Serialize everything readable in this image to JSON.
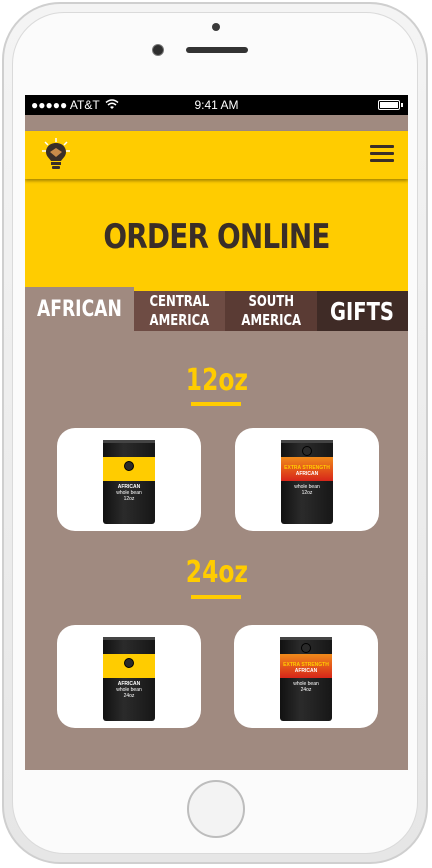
{
  "status": {
    "carrier": "●●●●● AT&T",
    "time": "9:41 AM"
  },
  "nav": {
    "logo_icon": "lightbulb-logo",
    "menu_icon": "hamburger-icon"
  },
  "hero": {
    "title": "ORDER ONLINE"
  },
  "tabs": [
    {
      "label": "AFRICAN"
    },
    {
      "label": "CENTRAL\nAMERICA"
    },
    {
      "label": "SOUTH\nAMERICA"
    },
    {
      "label": "GIFTS"
    }
  ],
  "sections": [
    {
      "title": "12oz",
      "products": [
        {
          "name": "AFRICAN",
          "desc": "whole bean",
          "size": "12oz"
        },
        {
          "strength": "EXTRA STRENGTH",
          "name": "AFRICAN",
          "desc": "whole bean",
          "size": "12oz"
        }
      ]
    },
    {
      "title": "24oz",
      "products": [
        {
          "name": "AFRICAN",
          "desc": "whole bean",
          "size": "24oz"
        },
        {
          "strength": "EXTRA STRENGTH",
          "name": "AFRICAN",
          "desc": "whole bean",
          "size": "24oz"
        }
      ]
    }
  ],
  "colors": {
    "brand_yellow": "#ffcc00",
    "background": "#a08a80",
    "dark_brown": "#3a2e28"
  }
}
